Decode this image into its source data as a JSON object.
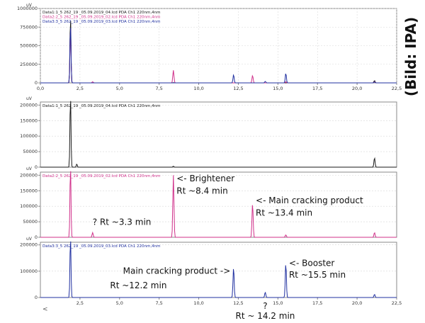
{
  "credit": "(Bild: IPA)",
  "colors": {
    "data1": "#1a1a1a",
    "data2": "#d0308a",
    "data3": "#2030a0",
    "frame": "#888888",
    "grid": "#d8d8d8",
    "tick": "#333333"
  },
  "chart_data": [
    {
      "type": "line",
      "title": "",
      "ylabel": "uV",
      "xlabel": "",
      "xlim": [
        0,
        22.5
      ],
      "ylim": [
        0,
        1000000
      ],
      "x_ticks": [
        "0,0",
        "2,5",
        "5,0",
        "7,5",
        "10,0",
        "12,5",
        "15,0",
        "17,5",
        "20,0",
        "22,5"
      ],
      "y_ticks": [
        "1000000",
        "750000",
        "500000",
        "250000",
        "0"
      ],
      "legend": [
        "Data1:1_5 262_19 _05.09.2019_04.lcd PDA Ch1 220nm,4nm",
        "Data2:2_5 262_19 _05.09.2019_02.lcd PDA Ch1 220nm,4nm",
        "Data3:3_5 262_19 _05.09.2019_03.lcd PDA Ch1 220nm,4nm"
      ],
      "legend_position": "top-left",
      "series": [
        {
          "name": "Data1:1_5 262_19 _05.09.2019_04.lcd PDA Ch1 220nm,4nm",
          "peaks": [
            [
              1.9,
              900000
            ],
            [
              8.4,
              4000
            ],
            [
              21.1,
              30000
            ]
          ]
        },
        {
          "name": "Data2:2_5 262_19 _05.09.2019_02.lcd PDA Ch1 220nm,4nm",
          "peaks": [
            [
              1.9,
              780000
            ],
            [
              3.3,
              15000
            ],
            [
              8.4,
              170000
            ],
            [
              13.4,
              100000
            ],
            [
              15.5,
              15000
            ],
            [
              21.1,
              15000
            ]
          ]
        },
        {
          "name": "Data3:3_5 262_19 _05.09.2019_03.lcd PDA Ch1 220nm,4nm",
          "peaks": [
            [
              1.9,
              800000
            ],
            [
              12.2,
              110000
            ],
            [
              14.2,
              20000
            ],
            [
              15.5,
              130000
            ],
            [
              21.1,
              12000
            ]
          ]
        }
      ],
      "annotations": []
    },
    {
      "type": "line",
      "title": "",
      "ylabel": "uV",
      "xlabel": "",
      "xlim": [
        0,
        22.5
      ],
      "ylim": [
        0,
        210000
      ],
      "x_ticks": [],
      "y_ticks": [
        "200000",
        "150000",
        "100000",
        "50000",
        "0"
      ],
      "legend": [
        "Data1:1_5 262_19 _05.09.2019_04.lcd PDA Ch1 220nm,4nm"
      ],
      "legend_position": "top-left",
      "series": [
        {
          "name": "Data1:1_5 262_19 _05.09.2019_04.lcd PDA Ch1 220nm,4nm",
          "peaks": [
            [
              1.9,
              230000
            ],
            [
              2.3,
              10000
            ],
            [
              8.4,
              3000
            ],
            [
              21.1,
              30000
            ]
          ]
        }
      ],
      "annotations": []
    },
    {
      "type": "line",
      "title": "",
      "ylabel": "uV",
      "xlabel": "",
      "xlim": [
        0,
        22.5
      ],
      "ylim": [
        0,
        210000
      ],
      "x_ticks": [],
      "y_ticks": [
        "200000",
        "150000",
        "100000",
        "50000",
        "0"
      ],
      "legend": [
        "Data2:2_5 262_19 _05.09.2019_02.lcd PDA Ch1 220nm,4nm"
      ],
      "legend_position": "top-left",
      "series": [
        {
          "name": "Data2:2_5 262_19 _05.09.2019_02.lcd PDA Ch1 220nm,4nm",
          "peaks": [
            [
              1.9,
              230000
            ],
            [
              3.3,
              15000
            ],
            [
              8.4,
              200000
            ],
            [
              13.4,
              110000
            ],
            [
              15.5,
              8000
            ],
            [
              21.1,
              15000
            ]
          ]
        }
      ],
      "annotations": [
        {
          "text": "? Rt ~3.3 min",
          "x": 3.3,
          "y": 40000
        },
        {
          "text": "<- Brightener",
          "x": 8.6,
          "y": 180000
        },
        {
          "text": "Rt ~8.4 min",
          "x": 8.6,
          "y": 140000
        },
        {
          "text": "<- Main cracking product",
          "x": 13.6,
          "y": 110000
        },
        {
          "text": "Rt ~13.4 min",
          "x": 13.6,
          "y": 70000
        }
      ]
    },
    {
      "type": "line",
      "title": "",
      "ylabel": "uV",
      "xlabel": "",
      "xlim": [
        0,
        22.5
      ],
      "ylim": [
        0,
        210000
      ],
      "x_ticks": [
        "2,5",
        "5,0",
        "7,5",
        "10,0",
        "12,5",
        "15,0",
        "17,5",
        "20,0",
        "22,5"
      ],
      "y_ticks": [
        "200000",
        "100000",
        "0"
      ],
      "legend": [
        "Data3:3_5 262_19 _05.09.2019_03.lcd PDA Ch1 220nm,4nm"
      ],
      "legend_position": "top-left",
      "series": [
        {
          "name": "Data3:3_5 262_19 _05.09.2019_03.lcd PDA Ch1 220nm,4nm",
          "peaks": [
            [
              1.9,
              230000
            ],
            [
              12.2,
              115000
            ],
            [
              14.2,
              20000
            ],
            [
              15.5,
              130000
            ],
            [
              21.1,
              12000
            ]
          ]
        }
      ],
      "annotations": [
        {
          "text": "Main cracking product ->",
          "x": 12.0,
          "y": 90000,
          "anchor": "end"
        },
        {
          "text": "Rt ~12.2 min",
          "x": 4.4,
          "y": 35000
        },
        {
          "text": "<- Booster",
          "x": 15.7,
          "y": 120000
        },
        {
          "text": "Rt ~15.5 min",
          "x": 15.7,
          "y": 75000
        }
      ]
    }
  ],
  "footer_annotations": [
    {
      "text": "?",
      "x": 14.2
    },
    {
      "text": "Rt ~ 14.2 min",
      "x": 14.2
    }
  ]
}
